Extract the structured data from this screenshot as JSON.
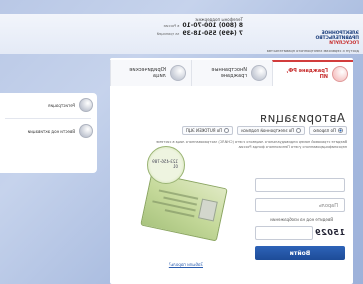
{
  "header": {
    "logo": {
      "line1": "ЭЛЕКТРОННОЕ",
      "line2": "ПРАВИТЕЛЬСТВО",
      "line3": "ГОСУСЛУГИ",
      "subtitle": "доступ к сервисам электронного правительства"
    },
    "phones": {
      "title": "Телефоны поддержки:",
      "phone1": "8 (800) 100-70-10",
      "note1": "в России",
      "phone2": "7 (499) 550-18-39",
      "note2": "за границей"
    }
  },
  "tabs": [
    {
      "label": "Граждане РФ, ИП"
    },
    {
      "label": "Иностранные граждане"
    },
    {
      "label": "Юридические лица"
    }
  ],
  "auth": {
    "title": "Авторизация",
    "methods": [
      {
        "label": "По паролю"
      },
      {
        "label": "По электронной подписи"
      },
      {
        "label": "По RUTOKEN ЭЦП"
      }
    ],
    "description": "Введите страховой номер индивидуального лицевого счета (СНИЛС) застрахованного лица в системе персонифицированного учета Пенсионного фонда России.",
    "password_placeholder": "Пароль",
    "captcha_label": "Введите код на изображении",
    "captcha_code": "15029",
    "login_button": "Войти",
    "card_zoom_text": "123-456-789 01",
    "card_link": "Забыли пароль?"
  },
  "sidebar": {
    "items": [
      {
        "label": "Регистрация"
      },
      {
        "label": "Ввести код активации"
      }
    ]
  },
  "colors": {
    "accent": "#c62828",
    "primary": "#1d4c98",
    "background": "#b9c8e6"
  }
}
